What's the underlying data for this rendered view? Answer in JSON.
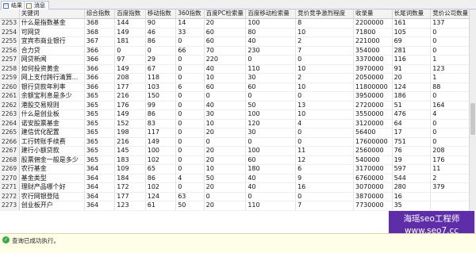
{
  "tabs": [
    {
      "label": "结果",
      "icon": "grid-icon"
    },
    {
      "label": "消息",
      "icon": "message-icon"
    }
  ],
  "columns": [
    "关键词",
    "综合指数",
    "百度指数",
    "移动指数",
    "360指数",
    "百度PC检索量",
    "百度移动检索量",
    "竞价竞争激烈程度",
    "收录量",
    "长尾词数量",
    "竞价公司数量"
  ],
  "rows": [
    [
      "2253",
      "什么是指数基金",
      "368",
      "144",
      "90",
      "14",
      "20",
      "100",
      "8",
      "2200000",
      "161",
      "137"
    ],
    [
      "2254",
      "可网贷",
      "368",
      "149",
      "46",
      "33",
      "60",
      "80",
      "10",
      "71800",
      "105",
      "0"
    ],
    [
      "2255",
      "宜宾市商业银行",
      "367",
      "181",
      "86",
      "0",
      "60",
      "40",
      "2",
      "221000",
      "69",
      "0"
    ],
    [
      "2256",
      "合力贷",
      "366",
      "0",
      "0",
      "66",
      "70",
      "230",
      "7",
      "354000",
      "281",
      "0"
    ],
    [
      "2257",
      "网贷新闻",
      "366",
      "97",
      "29",
      "0",
      "220",
      "0",
      "0",
      "3370000",
      "116",
      "1"
    ],
    [
      "2258",
      "如何投资黄金",
      "366",
      "149",
      "67",
      "0",
      "40",
      "110",
      "10",
      "3970000",
      "91",
      "123"
    ],
    [
      "2259",
      "网上支付跨行清算...",
      "366",
      "208",
      "118",
      "0",
      "10",
      "30",
      "2",
      "2050000",
      "20",
      "1"
    ],
    [
      "2260",
      "银行贷款年利率",
      "366",
      "177",
      "103",
      "6",
      "60",
      "60",
      "10",
      "11800000",
      "124",
      "88"
    ],
    [
      "2261",
      "余额宝利息是多少",
      "365",
      "216",
      "150",
      "0",
      "0",
      "0",
      "0",
      "3950000",
      "186",
      "0"
    ],
    [
      "2262",
      "港股交易规则",
      "365",
      "176",
      "99",
      "0",
      "40",
      "50",
      "13",
      "2720000",
      "51",
      "164"
    ],
    [
      "2263",
      "什么是创业板",
      "365",
      "149",
      "86",
      "0",
      "30",
      "100",
      "10",
      "3550000",
      "476",
      "4"
    ],
    [
      "2264",
      "诺安股票基金",
      "365",
      "152",
      "83",
      "0",
      "10",
      "120",
      "4",
      "3120000",
      "64",
      "0"
    ],
    [
      "2265",
      "建信优化配置",
      "365",
      "198",
      "117",
      "0",
      "20",
      "30",
      "0",
      "56400",
      "17",
      "0"
    ],
    [
      "2266",
      "工行转账手续费",
      "365",
      "216",
      "149",
      "0",
      "0",
      "0",
      "0",
      "17600000",
      "751",
      "0"
    ],
    [
      "2267",
      "建行小额贷款",
      "365",
      "145",
      "100",
      "0",
      "20",
      "100",
      "11",
      "2560000",
      "76",
      "208"
    ],
    [
      "2268",
      "股票佣金一般是多少",
      "365",
      "183",
      "102",
      "0",
      "20",
      "60",
      "12",
      "540000",
      "19",
      "176"
    ],
    [
      "2269",
      "农行基金",
      "364",
      "109",
      "65",
      "0",
      "10",
      "180",
      "6",
      "3170000",
      "597",
      "11"
    ],
    [
      "2270",
      "基金类型",
      "364",
      "184",
      "86",
      "4",
      "50",
      "40",
      "9",
      "6760000",
      "544",
      "2"
    ],
    [
      "2271",
      "理财产品哪个好",
      "364",
      "172",
      "102",
      "0",
      "20",
      "40",
      "16",
      "3070000",
      "280",
      "379"
    ],
    [
      "2272",
      "农行网银登陆",
      "364",
      "177",
      "124",
      "63",
      "0",
      "0",
      "0",
      "3870000",
      "16",
      ""
    ],
    [
      "2273",
      "创业板开户",
      "364",
      "123",
      "61",
      "50",
      "20",
      "110",
      "7",
      "7730000",
      "35",
      ""
    ]
  ],
  "status": {
    "text": "查询已成功执行。",
    "icon": "success-check-icon"
  },
  "watermark": {
    "line1": "海瑶seo工程师",
    "line2": "www.seo7.cc"
  }
}
